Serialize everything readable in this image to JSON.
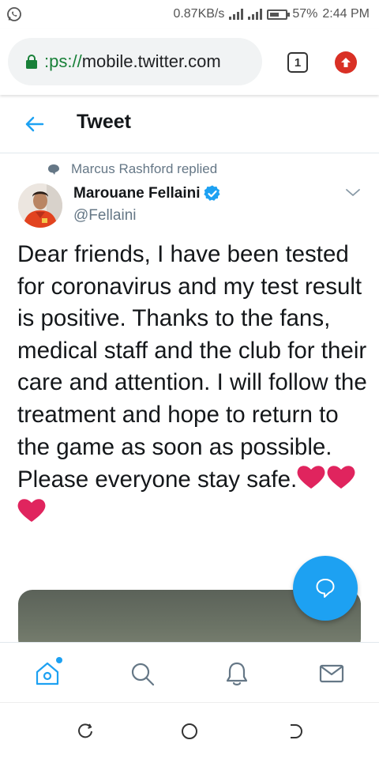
{
  "status_bar": {
    "speed": "0.87KB/s",
    "battery": "57%",
    "battery_level": 0.57,
    "time": "2:44 PM"
  },
  "browser": {
    "url_scheme": ":ps://",
    "url_host": "mobile.twitter.com",
    "tab_count": "1"
  },
  "header": {
    "title": "Tweet"
  },
  "tweet": {
    "context": "Marcus Rashford replied",
    "author_name": "Marouane Fellaini",
    "author_handle": "@Fellaini",
    "text": "Dear friends, I have been tested for coronavirus and my test result is positive. Thanks to the fans, medical staff and the club for their care and attention. I will follow the treatment and hope to return to the game as soon as possible. Please everyone stay safe.",
    "heart_count": 3
  },
  "colors": {
    "accent": "#1da1f2",
    "secure_green": "#188038",
    "update_red": "#d93025",
    "heart": "#e0245e"
  },
  "icons": {
    "status": [
      "whatsapp-icon",
      "signal-icon",
      "battery-icon"
    ],
    "browser": [
      "lock-icon",
      "tabs-icon",
      "update-icon"
    ],
    "nav": [
      "home-icon",
      "search-icon",
      "notifications-icon",
      "messages-icon"
    ],
    "fab": "compose-reply-icon",
    "android": [
      "recents-icon",
      "home-circle-icon",
      "back-icon"
    ]
  }
}
